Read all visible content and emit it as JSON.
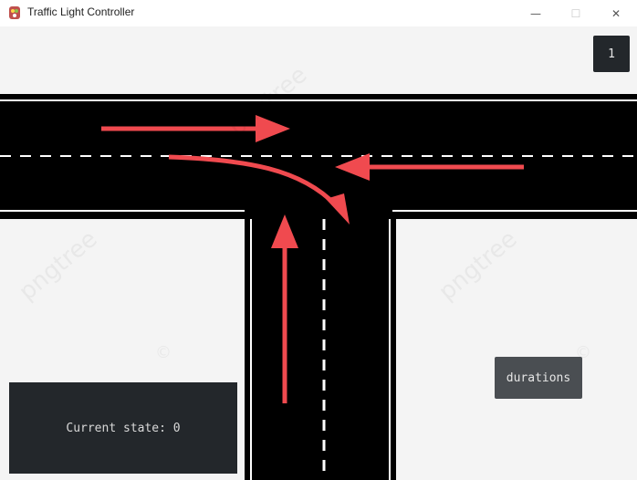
{
  "window": {
    "title": "Traffic Light Controller",
    "minimize_glyph": "—",
    "maximize_glyph": "☐",
    "close_glyph": "✕"
  },
  "counter": {
    "value": "1"
  },
  "state_panel": {
    "label": "Current state: 0"
  },
  "durations_button": {
    "label": "durations"
  },
  "watermark": {
    "text": "pngtree",
    "symbol": "©"
  },
  "colors": {
    "road": "#000000",
    "arrow": "#f04a4f",
    "panel": "#23272b",
    "button": "#4a4e52",
    "background": "#f4f4f4"
  },
  "icons": {
    "app": "traffic-light-icon"
  }
}
